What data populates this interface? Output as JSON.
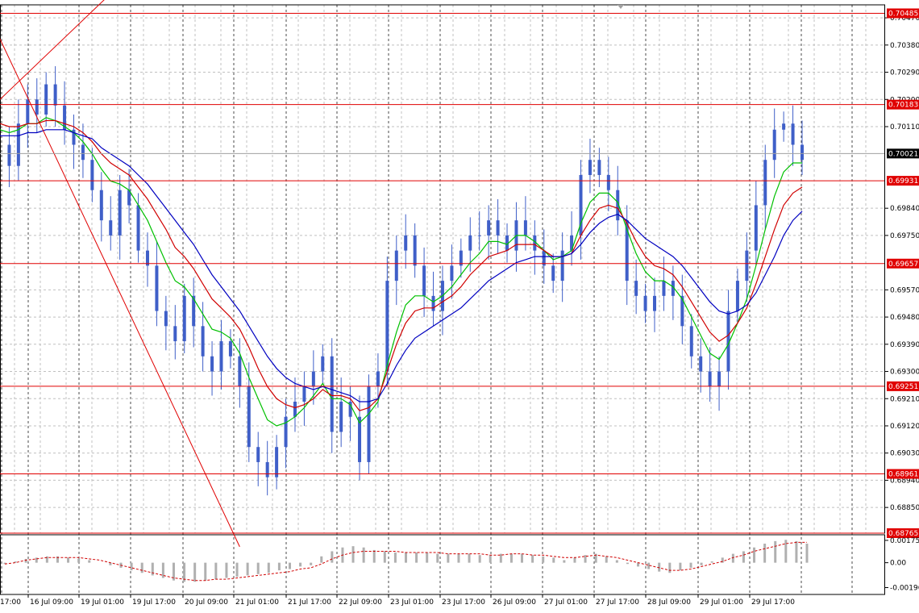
{
  "colors": {
    "background": "#ffffff",
    "grid": "#c0c0c0",
    "candle": "#3f5fc8",
    "level_line": "#e00000",
    "level_label_bg": "#e00000",
    "current_label_bg": "#000000",
    "ma_fast": "#00c000",
    "ma_mid": "#d00000",
    "ma_slow": "#0000c0",
    "trendline": "#e00000",
    "osc_hist": "#b0b0b0",
    "osc_signal": "#d00000",
    "axis_text": "#000000"
  },
  "chart_data": [
    {
      "type": "line",
      "yaxis_ticks": [
        "0.70470",
        "0.70380",
        "0.70290",
        "0.70200",
        "0.70110",
        "0.69840",
        "0.69750",
        "0.69570",
        "0.69480",
        "0.69390",
        "0.69300",
        "0.69210",
        "0.69120",
        "0.69030",
        "0.68940",
        "0.68850"
      ],
      "xaxis_ticks": [
        "16 Jul 09:00",
        "19 Jul 01:00",
        "19 Jul 17:00",
        "20 Jul 09:00",
        "21 Jul 01:00",
        "21 Jul 17:00",
        "22 Jul 09:00",
        "23 Jul 01:00",
        "23 Jul 17:00",
        "26 Jul 09:00",
        "27 Jul 01:00",
        "27 Jul 17:00",
        "28 Jul 09:00",
        "29 Jul 01:00",
        "29 Jul 17:00"
      ],
      "first_xtick_partial": "17:00",
      "ylim": [
        0.68765,
        0.70513
      ],
      "grid": true,
      "level_lines": [
        "0.70485",
        "0.70183",
        "0.69931",
        "0.69657",
        "0.69251",
        "0.68961",
        "0.68765"
      ],
      "current_price": "0.70021",
      "price_series": [
        0.7005,
        0.6998,
        0.7012,
        0.702,
        0.7015,
        0.7025,
        0.7018,
        0.701,
        0.7005,
        0.7,
        0.699,
        0.698,
        0.6975,
        0.699,
        0.6985,
        0.697,
        0.6965,
        0.695,
        0.6945,
        0.694,
        0.6955,
        0.6945,
        0.6935,
        0.693,
        0.694,
        0.6935,
        0.6925,
        0.6905,
        0.69,
        0.6895,
        0.6905,
        0.6915,
        0.692,
        0.6925,
        0.693,
        0.6935,
        0.691,
        0.692,
        0.6915,
        0.69,
        0.6925,
        0.693,
        0.696,
        0.697,
        0.6975,
        0.6965,
        0.6955,
        0.695,
        0.696,
        0.6965,
        0.697,
        0.6975,
        0.6975,
        0.698,
        0.6975,
        0.697,
        0.698,
        0.6975,
        0.697,
        0.6965,
        0.696,
        0.697,
        0.6975,
        0.6995,
        0.7,
        0.6995,
        0.699,
        0.698,
        0.696,
        0.6955,
        0.695,
        0.6955,
        0.696,
        0.6955,
        0.6945,
        0.6935,
        0.693,
        0.6925,
        0.693,
        0.695,
        0.696,
        0.697,
        0.6985,
        0.7,
        0.701,
        0.7012,
        0.7005,
        0.7
      ],
      "series": [
        {
          "values": [
            0.701,
            0.7009,
            0.701,
            0.7012,
            0.7012,
            0.7014,
            0.7013,
            0.7011,
            0.7009,
            0.7006,
            0.7002,
            0.6997,
            0.6993,
            0.6992,
            0.699,
            0.6985,
            0.698,
            0.6973,
            0.6966,
            0.696,
            0.6958,
            0.6954,
            0.6949,
            0.6944,
            0.6943,
            0.6941,
            0.6936,
            0.6928,
            0.6921,
            0.6914,
            0.6912,
            0.6913,
            0.6915,
            0.6918,
            0.6922,
            0.6926,
            0.6921,
            0.6921,
            0.6919,
            0.6913,
            0.6916,
            0.692,
            0.6932,
            0.6943,
            0.6952,
            0.6955,
            0.6955,
            0.6953,
            0.6955,
            0.6958,
            0.6962,
            0.6966,
            0.6969,
            0.6973,
            0.6973,
            0.6972,
            0.6975,
            0.6975,
            0.6973,
            0.697,
            0.6967,
            0.6968,
            0.697,
            0.6979,
            0.6986,
            0.6989,
            0.6989,
            0.6986,
            0.6977,
            0.6969,
            0.6963,
            0.696,
            0.696,
            0.6958,
            0.6954,
            0.6948,
            0.6942,
            0.6936,
            0.6934,
            0.6939,
            0.6946,
            0.6954,
            0.6965,
            0.6977,
            0.6988,
            0.6996,
            0.6999,
            0.6999
          ]
        },
        {
          "values": [
            0.7012,
            0.7011,
            0.7011,
            0.7012,
            0.7012,
            0.7013,
            0.7013,
            0.7012,
            0.7011,
            0.7009,
            0.7006,
            0.7002,
            0.6999,
            0.6997,
            0.6995,
            0.6991,
            0.6987,
            0.6982,
            0.6977,
            0.6971,
            0.6968,
            0.6964,
            0.6959,
            0.6954,
            0.6951,
            0.6948,
            0.6944,
            0.6938,
            0.6931,
            0.6925,
            0.6921,
            0.6919,
            0.6918,
            0.6919,
            0.6921,
            0.6924,
            0.6922,
            0.6922,
            0.6921,
            0.6917,
            0.6918,
            0.6921,
            0.693,
            0.6939,
            0.6946,
            0.695,
            0.6951,
            0.6951,
            0.6953,
            0.6955,
            0.6958,
            0.6962,
            0.6965,
            0.6968,
            0.6969,
            0.697,
            0.6972,
            0.6972,
            0.6972,
            0.697,
            0.6968,
            0.6968,
            0.6969,
            0.6975,
            0.698,
            0.6984,
            0.6985,
            0.6984,
            0.6979,
            0.6973,
            0.6968,
            0.6965,
            0.6964,
            0.6962,
            0.6958,
            0.6953,
            0.6948,
            0.6943,
            0.694,
            0.6942,
            0.6946,
            0.6951,
            0.6959,
            0.6968,
            0.6977,
            0.6985,
            0.6989,
            0.6991
          ]
        },
        {
          "values": [
            0.7008,
            0.7008,
            0.7008,
            0.7009,
            0.7009,
            0.701,
            0.701,
            0.701,
            0.7009,
            0.7008,
            0.7007,
            0.7004,
            0.7002,
            0.7,
            0.6998,
            0.6995,
            0.6992,
            0.6988,
            0.6984,
            0.698,
            0.6976,
            0.6972,
            0.6967,
            0.6962,
            0.6958,
            0.6954,
            0.695,
            0.6945,
            0.694,
            0.6935,
            0.6931,
            0.6928,
            0.6926,
            0.6925,
            0.6924,
            0.6925,
            0.6924,
            0.6923,
            0.6922,
            0.692,
            0.692,
            0.6921,
            0.6926,
            0.6932,
            0.6937,
            0.6941,
            0.6943,
            0.6945,
            0.6947,
            0.6949,
            0.6951,
            0.6954,
            0.6957,
            0.696,
            0.6962,
            0.6964,
            0.6966,
            0.6967,
            0.6968,
            0.6968,
            0.6968,
            0.6968,
            0.6969,
            0.6972,
            0.6976,
            0.6979,
            0.6981,
            0.6982,
            0.698,
            0.6977,
            0.6974,
            0.6972,
            0.697,
            0.6968,
            0.6965,
            0.6961,
            0.6957,
            0.6953,
            0.695,
            0.6949,
            0.695,
            0.6952,
            0.6956,
            0.6962,
            0.6968,
            0.6975,
            0.698,
            0.6983
          ]
        }
      ],
      "trendlines": [
        {
          "from": [
            0,
            0.704
          ],
          "to": [
            26,
            0.6872
          ]
        },
        {
          "from": [
            0,
            0.702
          ],
          "to": [
            12,
            0.7055
          ]
        }
      ]
    },
    {
      "type": "bar",
      "yaxis_ticks": [
        "0.001759",
        "0.00",
        "-0.00196"
      ],
      "ylim": [
        -0.0025,
        0.0022
      ],
      "values": [
        -0.0001,
        0.0001,
        0.0003,
        0.0004,
        0.0005,
        0.0005,
        0.0004,
        0.0003,
        0.0002,
        0.0,
        -0.0002,
        -0.0004,
        -0.0006,
        -0.0008,
        -0.001,
        -0.0012,
        -0.0014,
        -0.0015,
        -0.0015,
        -0.0014,
        -0.0013,
        -0.0012,
        -0.0011,
        -0.001,
        -0.0009,
        -0.0008,
        -0.0006,
        -0.0005,
        -0.0003,
        -0.0002,
        0.0005,
        0.0009,
        0.0012,
        0.0013,
        0.0012,
        0.001,
        0.0009,
        0.0008,
        0.0008,
        0.0008,
        0.0008,
        0.0007,
        0.0007,
        0.0007,
        0.0007,
        0.0006,
        0.0006,
        0.0007,
        0.0007,
        0.0007,
        0.0006,
        0.0005,
        0.0004,
        0.0002,
        0.0004,
        0.0006,
        0.0007,
        0.0005,
        0.0002,
        -0.0001,
        -0.0003,
        -0.0005,
        -0.0007,
        -0.0008,
        -0.0006,
        -0.0004,
        -0.0002,
        0.0001,
        0.0004,
        0.0007,
        0.0009,
        0.0012,
        0.0015,
        0.0017,
        0.0018,
        0.0017,
        0.0015
      ],
      "signal": [
        -0.0001,
        0.0,
        0.0002,
        0.0003,
        0.0004,
        0.0004,
        0.0004,
        0.0004,
        0.0003,
        0.0002,
        0.0,
        -0.0002,
        -0.0004,
        -0.0006,
        -0.0008,
        -0.001,
        -0.0012,
        -0.0013,
        -0.0014,
        -0.0014,
        -0.0013,
        -0.0013,
        -0.0012,
        -0.0011,
        -0.001,
        -0.0009,
        -0.0008,
        -0.0007,
        -0.0005,
        -0.0004,
        -0.0001,
        0.0003,
        0.0006,
        0.0008,
        0.0009,
        0.0009,
        0.0009,
        0.0009,
        0.0008,
        0.0008,
        0.0008,
        0.0008,
        0.0007,
        0.0007,
        0.0007,
        0.0007,
        0.0006,
        0.0006,
        0.0007,
        0.0007,
        0.0006,
        0.0006,
        0.0005,
        0.0004,
        0.0004,
        0.0005,
        0.0006,
        0.0005,
        0.0004,
        0.0002,
        0.0,
        -0.0002,
        -0.0004,
        -0.0006,
        -0.0006,
        -0.0005,
        -0.0003,
        -0.0001,
        0.0001,
        0.0004,
        0.0006,
        0.0009,
        0.0011,
        0.0013,
        0.0015,
        0.0016,
        0.0016
      ]
    }
  ]
}
